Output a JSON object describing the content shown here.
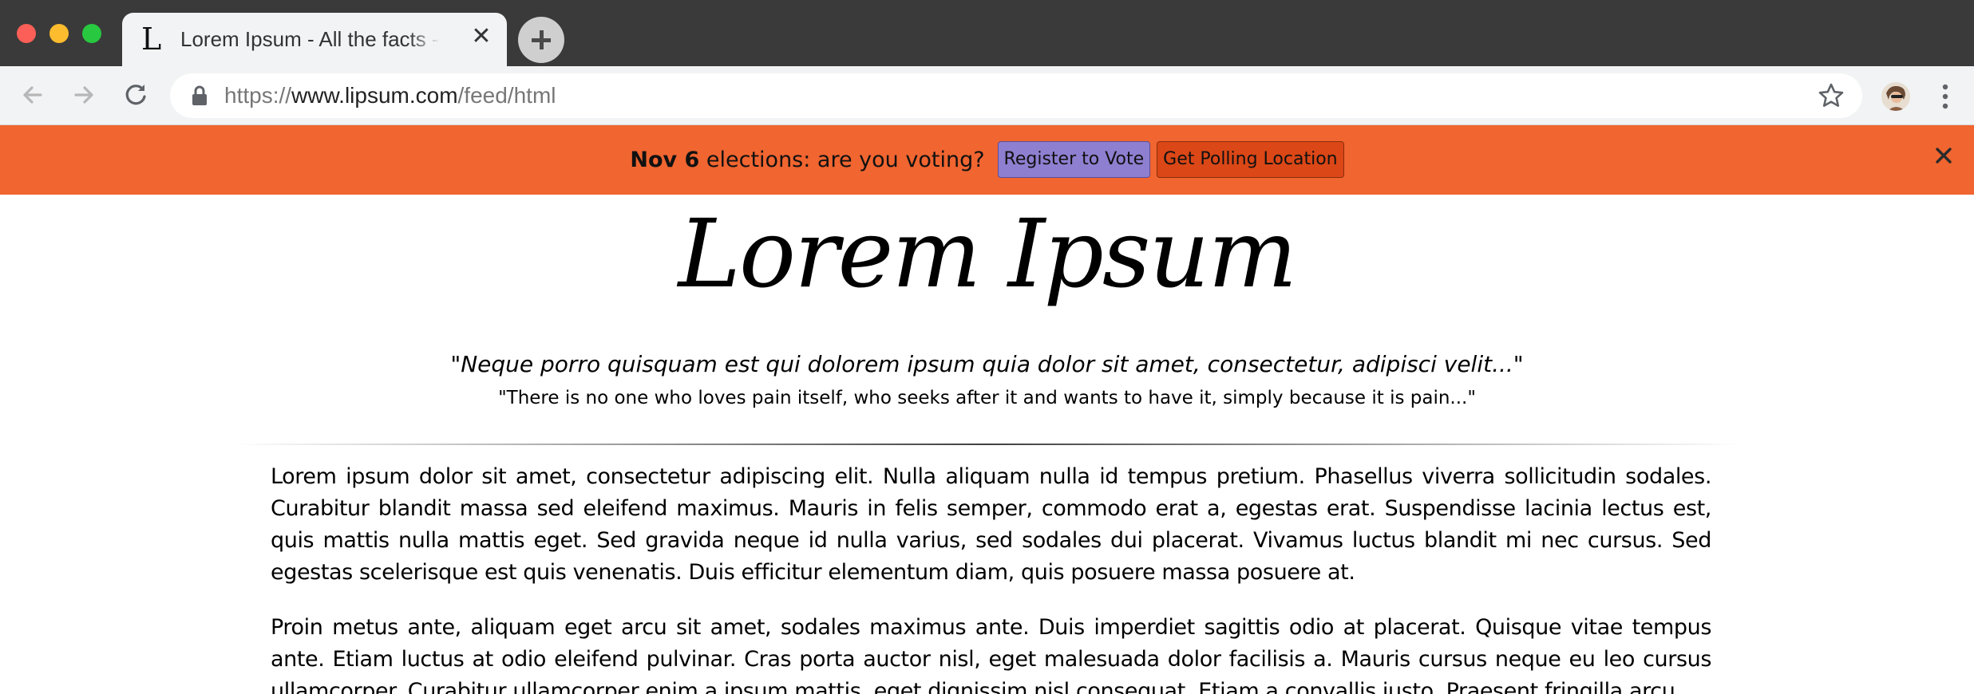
{
  "browser": {
    "tab_title": "Lorem Ipsum - All the facts - Lipsum generator",
    "tab_favicon": "L",
    "tab_close_glyph": "✕",
    "url_scheme": "https://",
    "url_host": "www.lipsum.com",
    "url_path": "/feed/html"
  },
  "banner": {
    "bold_text": "Nov 6",
    "text": " elections: are you voting?",
    "register_label": "Register to Vote",
    "polling_label": "Get Polling Location",
    "colors": {
      "background": "#f06530",
      "register": "#8e7fd0",
      "polling": "#db4716"
    }
  },
  "page": {
    "logo": "Lorem Ipsum",
    "quote_latin": "\"Neque porro quisquam est qui dolorem ipsum quia dolor sit amet, consectetur, adipisci velit...\"",
    "quote_english": "\"There is no one who loves pain itself, who seeks after it and wants to have it, simply because it is pain...\"",
    "paragraphs": [
      "Lorem ipsum dolor sit amet, consectetur adipiscing elit. Nulla aliquam nulla id tempus pretium. Phasellus viverra sollicitudin sodales. Curabitur blandit massa sed eleifend maximus. Mauris in felis semper, commodo erat a, egestas erat. Suspendisse lacinia lectus est, quis mattis nulla mattis eget. Sed gravida neque id nulla varius, sed sodales dui placerat. Vivamus luctus blandit mi nec cursus. Sed egestas scelerisque est quis venenatis. Duis efficitur elementum diam, quis posuere massa posuere at.",
      "Proin metus ante, aliquam eget arcu sit amet, sodales maximus ante. Duis imperdiet sagittis odio at placerat. Quisque vitae tempus ante. Etiam luctus at odio eleifend pulvinar. Cras porta auctor nisl, eget malesuada dolor facilisis a. Mauris cursus neque eu leo cursus ullamcorper. Curabitur ullamcorper enim a ipsum mattis, eget dignissim nisl consequat. Etiam a convallis justo. Praesent fringilla arcu"
    ]
  },
  "icons": {
    "window_controls": [
      "close-window-icon",
      "minimize-window-icon",
      "maximize-window-icon"
    ],
    "toolbar": [
      "back-arrow-icon",
      "forward-arrow-icon",
      "reload-icon",
      "lock-icon",
      "star-icon",
      "avatar",
      "kebab-menu-icon"
    ],
    "banner": [
      "close-icon"
    ]
  }
}
